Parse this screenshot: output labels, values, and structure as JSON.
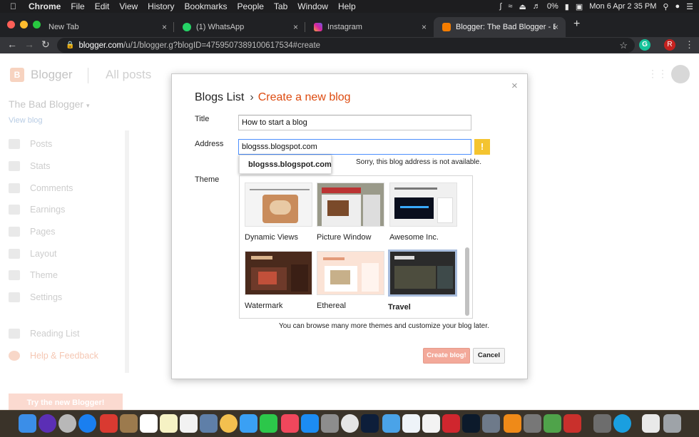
{
  "menubar": {
    "app": "Chrome",
    "items": [
      "File",
      "Edit",
      "View",
      "History",
      "Bookmarks",
      "People",
      "Tab",
      "Window",
      "Help"
    ],
    "battery": "0%",
    "clock": "Mon 6 Apr  2 35 PM"
  },
  "tabs": [
    {
      "label": "New Tab",
      "icon": "none"
    },
    {
      "label": "(1) WhatsApp",
      "icon": "whatsapp-icon"
    },
    {
      "label": "Instagram",
      "icon": "instagram-icon"
    },
    {
      "label": "Blogger: The Bad Blogger - Blo",
      "icon": "blogger-icon"
    }
  ],
  "address": {
    "host": "blogger.com",
    "path": "/u/1/blogger.g?blogID=4759507389100617534#create"
  },
  "extensions": {
    "grammarly": "G",
    "profile": "R"
  },
  "blogger": {
    "brand": "Blogger",
    "section": "All posts",
    "blog_name": "The Bad Blogger",
    "view_blog": "View blog",
    "nav": [
      "Posts",
      "Stats",
      "Comments",
      "Earnings",
      "Pages",
      "Layout",
      "Theme",
      "Settings"
    ],
    "nav_lower": [
      "Reading List",
      "Help & Feedback"
    ],
    "try_new": "Try the new Blogger!"
  },
  "dialog": {
    "crumb1": "Blogs List",
    "separator": "›",
    "crumb2": "Create a new blog",
    "title_label": "Title",
    "title_value": "How to start a blog",
    "address_label": "Address",
    "address_value": "blogsss.blogspot.com",
    "warning_glyph": "!",
    "address_error": "Sorry, this blog address is not available.",
    "suggestion": "blogsss.blogspot.com",
    "theme_label": "Theme",
    "themes": [
      "Dynamic Views",
      "Picture Window",
      "Awesome Inc.",
      "Watermark",
      "Ethereal",
      "Travel"
    ],
    "selected_theme": "Travel",
    "browse_note": "You can browse many more themes and customize your blog later.",
    "create_label": "Create blog!",
    "cancel_label": "Cancel",
    "close_glyph": "×"
  },
  "colors": {
    "accent": "#dd4b10",
    "focus": "#4d90fe",
    "warning": "#f4c430"
  }
}
